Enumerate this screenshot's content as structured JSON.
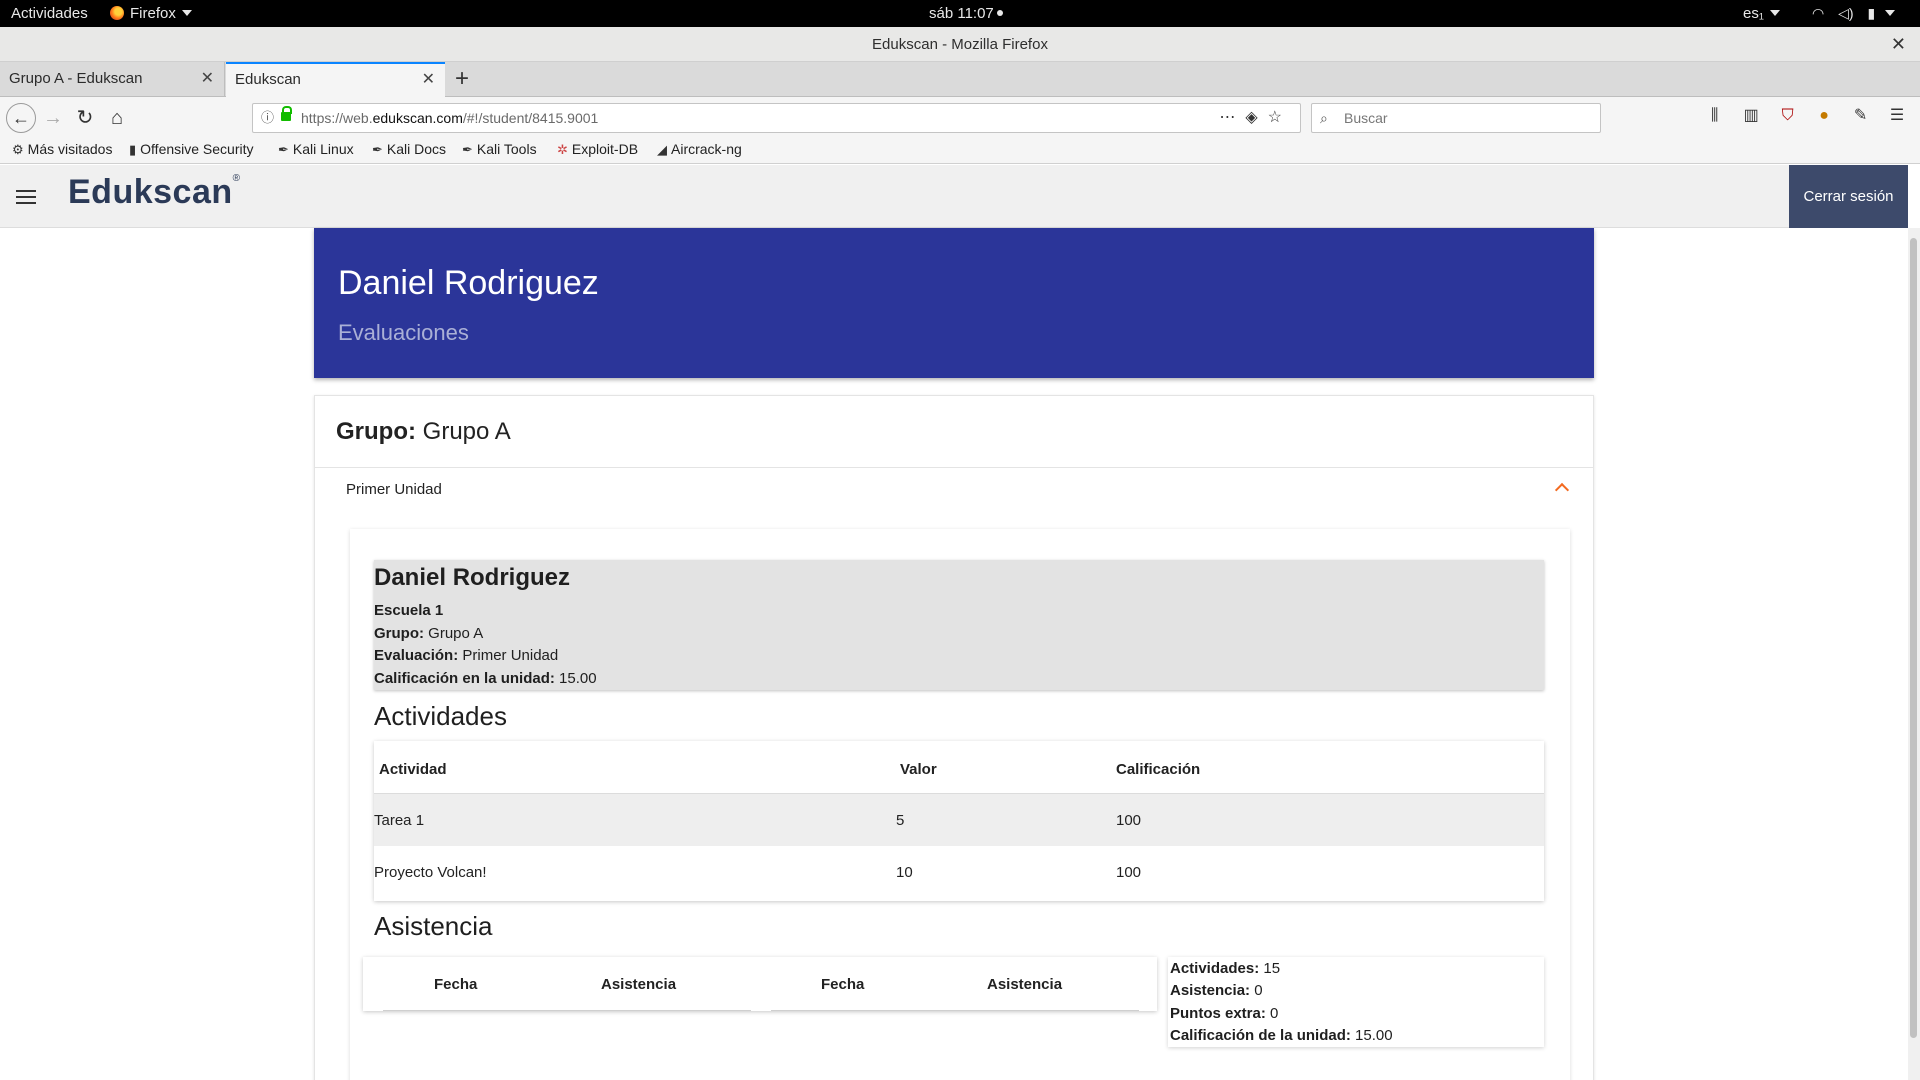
{
  "system_bar": {
    "activities": "Actividades",
    "app_menu": "Firefox",
    "clock": "sáb 11:07",
    "locale": "es₁"
  },
  "window": {
    "title": "Edukscan - Mozilla Firefox"
  },
  "tabs": [
    {
      "label": "Grupo A - Edukscan"
    },
    {
      "label": "Edukscan"
    }
  ],
  "navbar": {
    "url_prefix": "https://web.",
    "url_domain": "edukscan.com",
    "url_path": "/#!/student/8415.9001",
    "search_placeholder": "Buscar"
  },
  "bookmarks": [
    {
      "label": "Más visitados",
      "icon": "gear-icon"
    },
    {
      "label": "Offensive Security",
      "icon": "offsec-icon"
    },
    {
      "label": "Kali Linux",
      "icon": "kali-icon"
    },
    {
      "label": "Kali Docs",
      "icon": "kali-icon"
    },
    {
      "label": "Kali Tools",
      "icon": "kali-icon"
    },
    {
      "label": "Exploit-DB",
      "icon": "exploitdb-icon"
    },
    {
      "label": "Aircrack-ng",
      "icon": "aircrack-icon"
    }
  ],
  "app": {
    "logo": "Edukscan",
    "logo_mark": "®",
    "logout_label": "Cerrar sesión"
  },
  "hero": {
    "name": "Daniel Rodriguez",
    "subtitle": "Evaluaciones"
  },
  "group": {
    "label": "Grupo:",
    "value": "Grupo A",
    "unit_title": "Primer Unidad"
  },
  "summary": {
    "student_name": "Daniel Rodriguez",
    "school": "Escuela 1",
    "group_label": "Grupo:",
    "group_value": "Grupo A",
    "evaluation_label": "Evaluación:",
    "evaluation_value": "Primer Unidad",
    "grade_label": "Calificación en la unidad:",
    "grade_value": "15.00"
  },
  "activities": {
    "heading": "Actividades",
    "columns": [
      "Actividad",
      "Valor",
      "Calificación"
    ],
    "rows": [
      [
        "Tarea 1",
        "5",
        "100"
      ],
      [
        "Proyecto Volcan!",
        "10",
        "100"
      ]
    ]
  },
  "attendance": {
    "heading": "Asistencia",
    "columns": [
      "Fecha",
      "Asistencia",
      "Fecha",
      "Asistencia"
    ]
  },
  "totals": {
    "activities_label": "Actividades:",
    "activities_value": "15",
    "attendance_label": "Asistencia:",
    "attendance_value": "0",
    "extra_label": "Puntos extra:",
    "extra_value": "0",
    "unit_grade_label": "Calificación de la unidad:",
    "unit_grade_value": "15.00"
  },
  "colors": {
    "hero_bg": "#2b3599",
    "logout_bg": "#3d4a6b",
    "accent_chevron": "#f36a20"
  }
}
